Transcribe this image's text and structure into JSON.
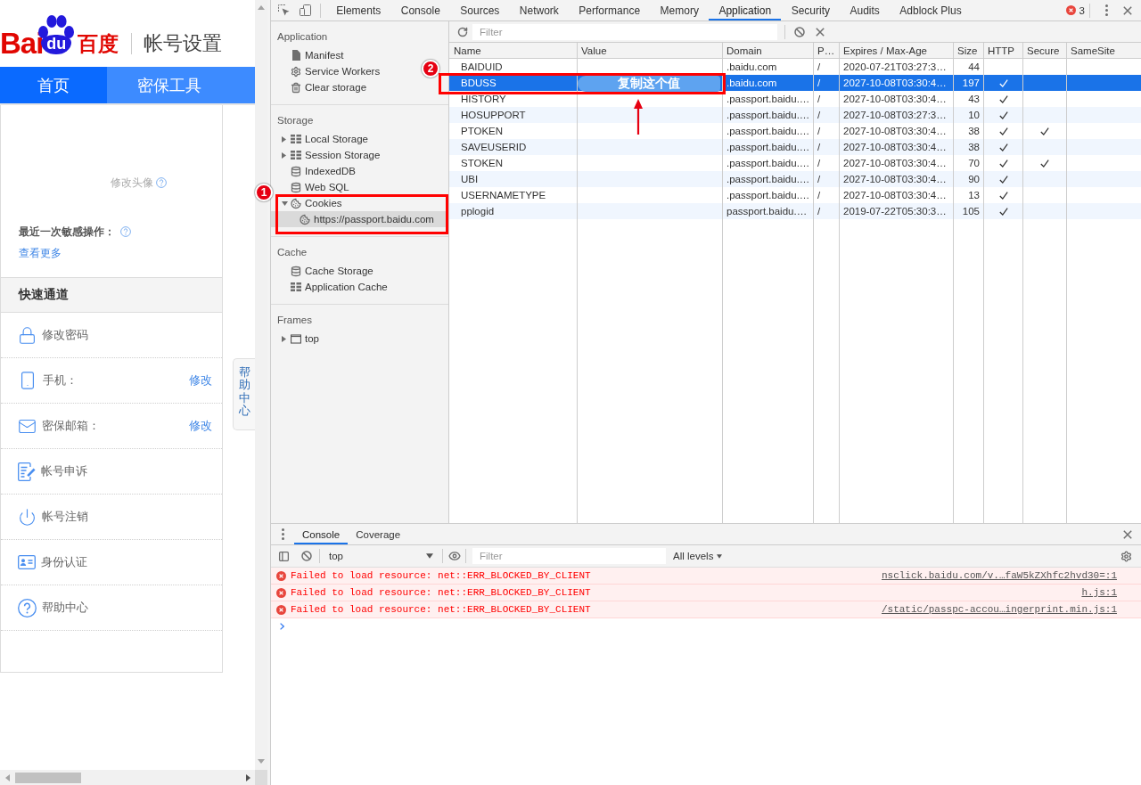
{
  "baidu_page": {
    "logo": {
      "latin": "Bai",
      "paw_text": "du",
      "chinese": "百度"
    },
    "title": "帐号设置",
    "nav_tabs": [
      {
        "label": "首页",
        "selected": true
      },
      {
        "label": "密保工具",
        "selected": false
      }
    ],
    "avatar_link": "修改头像",
    "recent_activity": {
      "label": "最近一次敏感操作：",
      "link": "查看更多"
    },
    "quick_links": {
      "title": "快速通道",
      "items": [
        {
          "kind": "lock",
          "label": "修改密码"
        },
        {
          "kind": "phone",
          "label": "手机：",
          "action": "修改"
        },
        {
          "kind": "mail",
          "label": "密保邮箱：",
          "action": "修改"
        },
        {
          "kind": "appeal",
          "label": "帐号申诉"
        },
        {
          "kind": "power",
          "label": "帐号注销"
        },
        {
          "kind": "id_card",
          "label": "身份认证"
        },
        {
          "kind": "help",
          "label": "帮助中心"
        }
      ]
    },
    "help_tab": "帮助中心"
  },
  "devtools": {
    "toolbar_tabs": [
      {
        "label": "Elements",
        "selected": false
      },
      {
        "label": "Console",
        "selected": false
      },
      {
        "label": "Sources",
        "selected": false
      },
      {
        "label": "Network",
        "selected": false
      },
      {
        "label": "Performance",
        "selected": false
      },
      {
        "label": "Memory",
        "selected": false
      },
      {
        "label": "Application",
        "selected": true
      },
      {
        "label": "Security",
        "selected": false
      },
      {
        "label": "Audits",
        "selected": false
      },
      {
        "label": "Adblock Plus",
        "selected": false
      }
    ],
    "error_count": "3",
    "sidebar": {
      "sections": [
        {
          "title": "Application",
          "items": [
            {
              "kind": "file",
              "label": "Manifest",
              "selected": false
            },
            {
              "kind": "gear",
              "label": "Service Workers",
              "selected": false
            },
            {
              "kind": "trash",
              "label": "Clear storage",
              "selected": false
            }
          ]
        },
        {
          "title": "Storage",
          "items": [
            {
              "kind": "grid",
              "label": "Local Storage",
              "expanded": false,
              "selected": false
            },
            {
              "kind": "grid",
              "label": "Session Storage",
              "expanded": false,
              "selected": false
            },
            {
              "kind": "database",
              "label": "IndexedDB",
              "selected": false
            },
            {
              "kind": "database",
              "label": "Web SQL",
              "selected": false
            },
            {
              "kind": "cookie",
              "label": "Cookies",
              "expanded": true,
              "selected": false,
              "children": [
                {
                  "kind": "cookie",
                  "label": "https://passport.baidu.com",
                  "selected": true
                }
              ]
            }
          ]
        },
        {
          "title": "Cache",
          "items": [
            {
              "kind": "database",
              "label": "Cache Storage",
              "selected": false
            },
            {
              "kind": "grid",
              "label": "Application Cache",
              "selected": false
            }
          ]
        },
        {
          "title": "Frames",
          "items": [
            {
              "kind": "frame",
              "label": "top",
              "expanded": false,
              "selected": false
            }
          ]
        }
      ]
    },
    "cookie_filter": {
      "placeholder": "Filter"
    },
    "cookies_table": {
      "columns": [
        "Name",
        "Value",
        "Domain",
        "P…",
        "Expires / Max-Age",
        "Size",
        "HTTP",
        "Secure",
        "SameSite"
      ],
      "rows": [
        {
          "name": "BAIDUID",
          "domain": ".baidu.com",
          "path": "/",
          "expires": "2020-07-21T03:27:3…",
          "size": "44",
          "http": false,
          "secure": false,
          "selected": false
        },
        {
          "name": "BDUSS",
          "domain": ".baidu.com",
          "path": "/",
          "expires": "2027-10-08T03:30:4…",
          "size": "197",
          "http": true,
          "secure": false,
          "selected": true
        },
        {
          "name": "HISTORY",
          "domain": ".passport.baidu.…",
          "path": "/",
          "expires": "2027-10-08T03:30:4…",
          "size": "43",
          "http": true,
          "secure": false,
          "selected": false
        },
        {
          "name": "HOSUPPORT",
          "domain": ".passport.baidu.…",
          "path": "/",
          "expires": "2027-10-08T03:27:3…",
          "size": "10",
          "http": true,
          "secure": false,
          "selected": false
        },
        {
          "name": "PTOKEN",
          "domain": ".passport.baidu.…",
          "path": "/",
          "expires": "2027-10-08T03:30:4…",
          "size": "38",
          "http": true,
          "secure": true,
          "selected": false
        },
        {
          "name": "SAVEUSERID",
          "domain": ".passport.baidu.…",
          "path": "/",
          "expires": "2027-10-08T03:30:4…",
          "size": "38",
          "http": true,
          "secure": false,
          "selected": false
        },
        {
          "name": "STOKEN",
          "domain": ".passport.baidu.…",
          "path": "/",
          "expires": "2027-10-08T03:30:4…",
          "size": "70",
          "http": true,
          "secure": true,
          "selected": false
        },
        {
          "name": "UBI",
          "domain": ".passport.baidu.…",
          "path": "/",
          "expires": "2027-10-08T03:30:4…",
          "size": "90",
          "http": true,
          "secure": false,
          "selected": false
        },
        {
          "name": "USERNAMETYPE",
          "domain": ".passport.baidu.…",
          "path": "/",
          "expires": "2027-10-08T03:30:4…",
          "size": "13",
          "http": true,
          "secure": false,
          "selected": false
        },
        {
          "name": "pplogid",
          "domain": "passport.baidu.…",
          "path": "/",
          "expires": "2019-07-22T05:30:3…",
          "size": "105",
          "http": true,
          "secure": false,
          "selected": false
        }
      ]
    },
    "drawer": {
      "tabs": [
        {
          "label": "Console",
          "selected": true
        },
        {
          "label": "Coverage",
          "selected": false
        }
      ],
      "context": "top",
      "filter": {
        "placeholder": "Filter"
      },
      "levels": "All levels",
      "messages": [
        {
          "kind": "error",
          "text": "Failed to load resource: net::ERR_BLOCKED_BY_CLIENT",
          "source": "nsclick.baidu.com/v.…faW5kZXhfc2hvd30=:1"
        },
        {
          "kind": "error",
          "text": "Failed to load resource: net::ERR_BLOCKED_BY_CLIENT",
          "source": "h.js:1"
        },
        {
          "kind": "error",
          "text": "Failed to load resource: net::ERR_BLOCKED_BY_CLIENT",
          "source": "/static/passpc-accou…ingerprint.min.js:1"
        }
      ]
    }
  },
  "annotations": {
    "markers": [
      {
        "label": "1"
      },
      {
        "label": "2"
      }
    ],
    "copy_hint": "复制这个值"
  }
}
